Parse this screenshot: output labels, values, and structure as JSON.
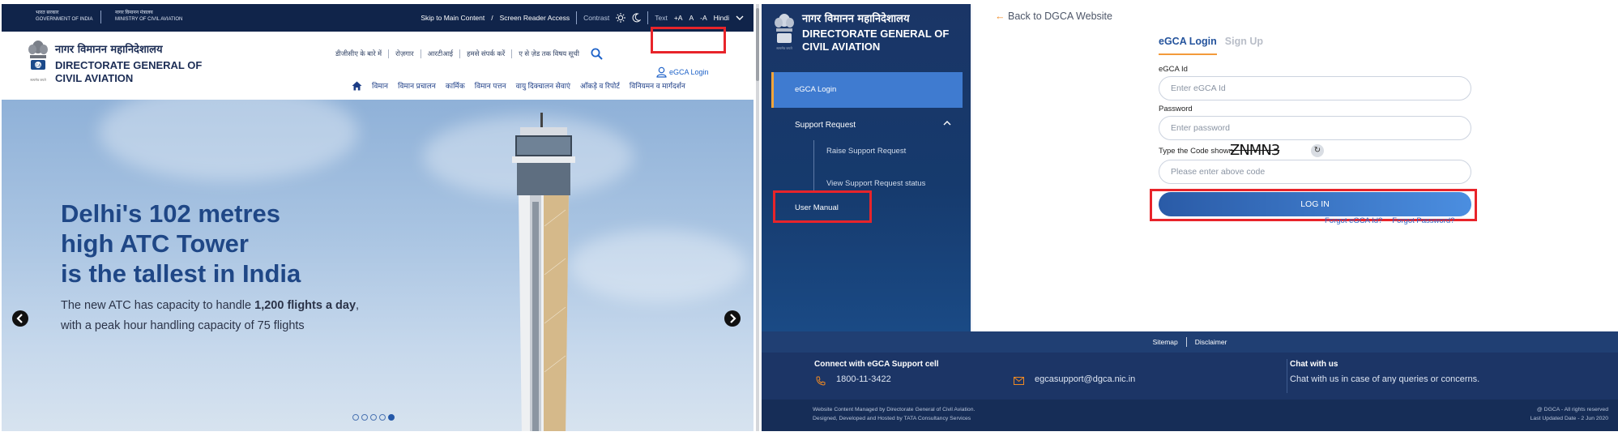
{
  "left": {
    "topbar": {
      "gov_hi": "भारत सरकार",
      "gov_en": "GOVERNMENT OF INDIA",
      "ministry_hi": "नागर विमानन मंत्रालय",
      "ministry_en": "MINISTRY OF CIVIL AVIATION",
      "skip": "Skip to Main Content",
      "slash": "/",
      "reader": "Screen Reader Access",
      "contrast": "Contrast",
      "text": "Text",
      "font_plus": "+A",
      "font_normal": "A",
      "font_minus": "-A",
      "language": "Hindi"
    },
    "header": {
      "brand_hi": "नागर विमानन महानिदेशालय",
      "brand_en_line1": "DIRECTORATE GENERAL OF",
      "brand_en_line2": "CIVIL AVIATION",
      "emblem_caption": "सत्यमेव जयते",
      "secondary_nav": [
        "डीजीसीए के बारे में",
        "रोज़गार",
        "आरटीआई",
        "हमसे संपर्क करें",
        "ए से ज़ेड तक विषय सूची"
      ],
      "egca_login": "eGCA Login",
      "main_nav": [
        "विमान",
        "विमान प्रचालन",
        "कार्मिक",
        "विमान पत्तन",
        "वायु दिक्चालन सेवाएं",
        "आँकड़े व रिपोर्ट",
        "विनियमन व मार्गदर्शन"
      ]
    },
    "hero": {
      "headline": [
        "Delhi's 102 metres",
        "high ATC Tower",
        "is the tallest in India"
      ],
      "sub_line1_a": "The new ATC has capacity to handle ",
      "sub_line1_bold": "1,200 flights a day",
      "sub_line1_c": ",",
      "sub_line2": "with a peak hour handling capacity of 75 flights",
      "slides": 5,
      "active_slide": 5
    }
  },
  "right": {
    "sidebar": {
      "brand_hi": "नागर विमानन महानिदेशालय",
      "brand_en_line1": "DIRECTORATE GENERAL OF",
      "brand_en_line2": "CIVIL AVIATION",
      "emblem_caption": "सत्यमेव जयते",
      "egca_login": "eGCA Login",
      "support_request": "Support Request",
      "raise_support": "Raise Support Request",
      "view_support": "View Support Request status",
      "user_manual": "User Manual"
    },
    "main": {
      "back_arrow": "←",
      "back_link": "Back to DGCA Website",
      "tab_login": "eGCA Login",
      "tab_signup": "Sign Up",
      "egca_id_label": "eGCA Id",
      "egca_id_placeholder": "Enter eGCA Id",
      "password_label": "Password",
      "password_placeholder": "Enter password",
      "captcha_label": "Type the Code shown",
      "captcha_code": "ZNMN3",
      "code_placeholder": "Please enter above code",
      "login_button": "LOG IN",
      "forgot_id": "Forgot eGCA Id?",
      "forgot_password": "Forgot Password?"
    },
    "footer": {
      "sitemap": "Sitemap",
      "disclaimer": "Disclaimer",
      "connect_heading": "Connect with eGCA Support cell",
      "phone": "1800-11-3422",
      "email": "egcasupport@dgca.nic.in",
      "chat_heading": "Chat with us",
      "chat_text": "Chat with us in case of any queries or concerns.",
      "managed_by": "Website Content Managed by Directorate General of Civil Aviation.",
      "hosted_by": "Designed, Developed and Hosted by TATA Consultancy Services",
      "rights": "@ DGCA - All rights reserved",
      "last_updated": "Last Updated Date - 2 Jun 2020"
    }
  },
  "colors": {
    "navy": "#10244a",
    "brand_blue": "#1c2d55",
    "link_blue": "#1e62c8",
    "highlight_red": "#e8242a",
    "accent_orange": "#f39a3a"
  }
}
